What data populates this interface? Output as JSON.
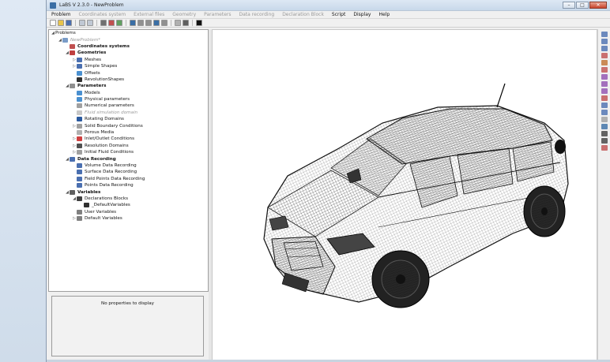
{
  "window": {
    "title": "LaBS V 2.3.0 - NewProblem",
    "controls": [
      "–",
      "□",
      "✕"
    ]
  },
  "menu": [
    {
      "label": "Problem",
      "enabled": true
    },
    {
      "label": "Coordinates system",
      "enabled": false
    },
    {
      "label": "External files",
      "enabled": false
    },
    {
      "label": "Geometry",
      "enabled": false
    },
    {
      "label": "Parameters",
      "enabled": false
    },
    {
      "label": "Data recording",
      "enabled": false
    },
    {
      "label": "Declaration Block",
      "enabled": false
    },
    {
      "label": "Script",
      "enabled": true
    },
    {
      "label": "Display",
      "enabled": true
    },
    {
      "label": "Help",
      "enabled": true
    }
  ],
  "toolbar": {
    "icons": [
      "new-file-icon",
      "open-folder-icon",
      "save-icon",
      "separator",
      "copy-icon",
      "paste-icon",
      "separator",
      "cut-icon",
      "axis-icon",
      "mesh-icon",
      "separator",
      "filter-icon",
      "grid-icon",
      "table-icon",
      "arrow-icon",
      "block-icon",
      "separator",
      "cube-icon",
      "image-icon",
      "separator",
      "run-icon"
    ],
    "colors": [
      "#ffffff",
      "#e8c44a",
      "#4a6fb0",
      "",
      "#c0c8d4",
      "#c0c8d4",
      "",
      "#707070",
      "#c05050",
      "#60a060",
      "",
      "#3a6ea5",
      "#909090",
      "#909090",
      "#3a6ea5",
      "#909090",
      "",
      "#b0b0b0",
      "#606060",
      "",
      "#111111"
    ]
  },
  "tree": [
    {
      "level": 0,
      "toggle": "◢",
      "label": "Problems",
      "icon": "",
      "style": ""
    },
    {
      "level": 1,
      "toggle": "◢",
      "label": "NewProblem*",
      "icon": "#7a9cc8",
      "style": "muted"
    },
    {
      "level": 2,
      "toggle": "",
      "label": "Coordinates systems",
      "icon": "#c05050",
      "style": "bold"
    },
    {
      "level": 2,
      "toggle": "◢",
      "label": "Geometries",
      "icon": "#c04040",
      "style": "bold"
    },
    {
      "level": 3,
      "toggle": "▷",
      "label": "Meshes",
      "icon": "#4a6fb0",
      "style": ""
    },
    {
      "level": 3,
      "toggle": "▷",
      "label": "Simple Shapes",
      "icon": "#4a6fb0",
      "style": ""
    },
    {
      "level": 3,
      "toggle": "",
      "label": "Offsets",
      "icon": "#4a90d0",
      "style": ""
    },
    {
      "level": 3,
      "toggle": "",
      "label": "RevolutionShapes",
      "icon": "#303030",
      "style": ""
    },
    {
      "level": 2,
      "toggle": "◢",
      "label": "Parameters",
      "icon": "#909090",
      "style": "bold"
    },
    {
      "level": 3,
      "toggle": "",
      "label": "Models",
      "icon": "#4a90d0",
      "style": ""
    },
    {
      "level": 3,
      "toggle": "",
      "label": "Physical parameters",
      "icon": "#4a90d0",
      "style": ""
    },
    {
      "level": 3,
      "toggle": "",
      "label": "Numerical parameters",
      "icon": "#a0a0a0",
      "style": ""
    },
    {
      "level": 3,
      "toggle": "",
      "label": "Fluid simulation domain",
      "icon": "#c8c8c8",
      "style": "muted"
    },
    {
      "level": 3,
      "toggle": "",
      "label": "Rotating Domains",
      "icon": "#2a5aa0",
      "style": ""
    },
    {
      "level": 3,
      "toggle": "▷",
      "label": "Solid Boundary Conditions",
      "icon": "#a0a0a0",
      "style": ""
    },
    {
      "level": 3,
      "toggle": "",
      "label": "Porous Media",
      "icon": "#b0b0b0",
      "style": ""
    },
    {
      "level": 3,
      "toggle": "▷",
      "label": "Inlet/Outlet Conditions",
      "icon": "#d04040",
      "style": ""
    },
    {
      "level": 3,
      "toggle": "▷",
      "label": "Resolution Domains",
      "icon": "#505050",
      "style": ""
    },
    {
      "level": 3,
      "toggle": "▷",
      "label": "Initial Fluid Conditions",
      "icon": "#a0a0a0",
      "style": ""
    },
    {
      "level": 2,
      "toggle": "◢",
      "label": "Data Recording",
      "icon": "#4a6fb0",
      "style": "bold"
    },
    {
      "level": 3,
      "toggle": "",
      "label": "Volume Data Recording",
      "icon": "#4a6fb0",
      "style": ""
    },
    {
      "level": 3,
      "toggle": "",
      "label": "Surface Data Recording",
      "icon": "#4a6fb0",
      "style": ""
    },
    {
      "level": 3,
      "toggle": "",
      "label": "Field Points Data Recording",
      "icon": "#4a6fb0",
      "style": ""
    },
    {
      "level": 3,
      "toggle": "",
      "label": "Points Data Recording",
      "icon": "#4a6fb0",
      "style": ""
    },
    {
      "level": 2,
      "toggle": "◢",
      "label": "Variables",
      "icon": "#606060",
      "style": "bold"
    },
    {
      "level": 3,
      "toggle": "◢",
      "label": "Declarations Blocks",
      "icon": "#404040",
      "style": ""
    },
    {
      "level": 4,
      "toggle": "",
      "label": "_DefaultVariables",
      "icon": "#303030",
      "style": ""
    },
    {
      "level": 3,
      "toggle": "",
      "label": "User Variables",
      "icon": "#808080",
      "style": ""
    },
    {
      "level": 3,
      "toggle": "▷",
      "label": "Default Variables",
      "icon": "#808080",
      "style": ""
    }
  ],
  "properties": {
    "message": "No properties to display"
  },
  "right_toolbar": {
    "icons": [
      "zoom-in-icon",
      "zoom-out-icon",
      "zoom-fit-icon",
      "axis-x-icon",
      "axis-y-icon",
      "axis-z-icon",
      "view-front-icon",
      "view-side-icon",
      "view-top-icon",
      "shading-icon",
      "light-icon",
      "camera-icon",
      "settings-icon",
      "palette-icon",
      "monitor-icon",
      "square-icon",
      "target-icon"
    ],
    "colors": [
      "#4a6fb0",
      "#4a6fb0",
      "#4a6fb0",
      "#c05050",
      "#c07030",
      "#c05050",
      "#9050b0",
      "#9050b0",
      "#9050b0",
      "#c05050",
      "#4a6fb0",
      "#4a6fb0",
      "#a0a0a0",
      "#3a6ea5",
      "#404040",
      "#404040",
      "#c05050"
    ]
  }
}
